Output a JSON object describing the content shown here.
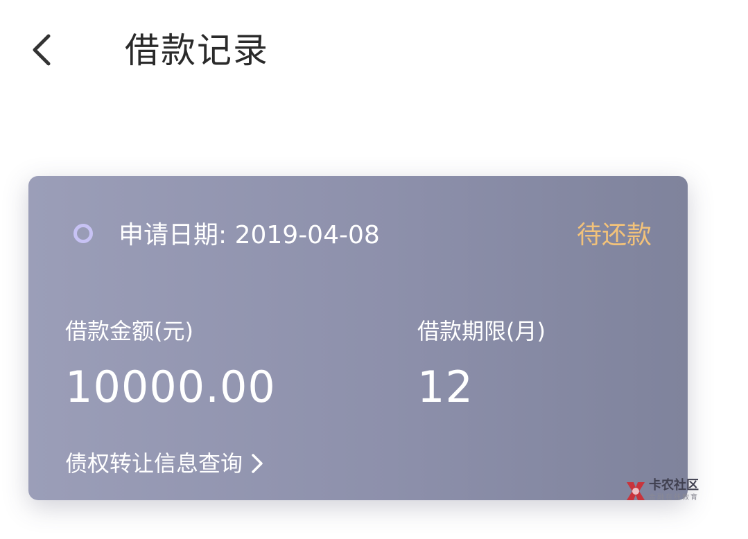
{
  "header": {
    "title": "借款记录",
    "back_icon": "chevron-left-icon"
  },
  "loan_card": {
    "apply_date_text": "申请日期: 2019-04-08",
    "status": "待还款",
    "status_ring_color": "#c7c2f4",
    "status_color": "#f2c27a",
    "amount": {
      "label": "借款金额(元)",
      "value": "10000.00"
    },
    "term": {
      "label": "借款期限(月)",
      "value": "12"
    },
    "transfer_link": {
      "label": "债权转让信息查询",
      "icon": "chevron-right-icon"
    }
  },
  "watermark": {
    "title": "卡农社区",
    "subtitle": "金融在线教育"
  }
}
